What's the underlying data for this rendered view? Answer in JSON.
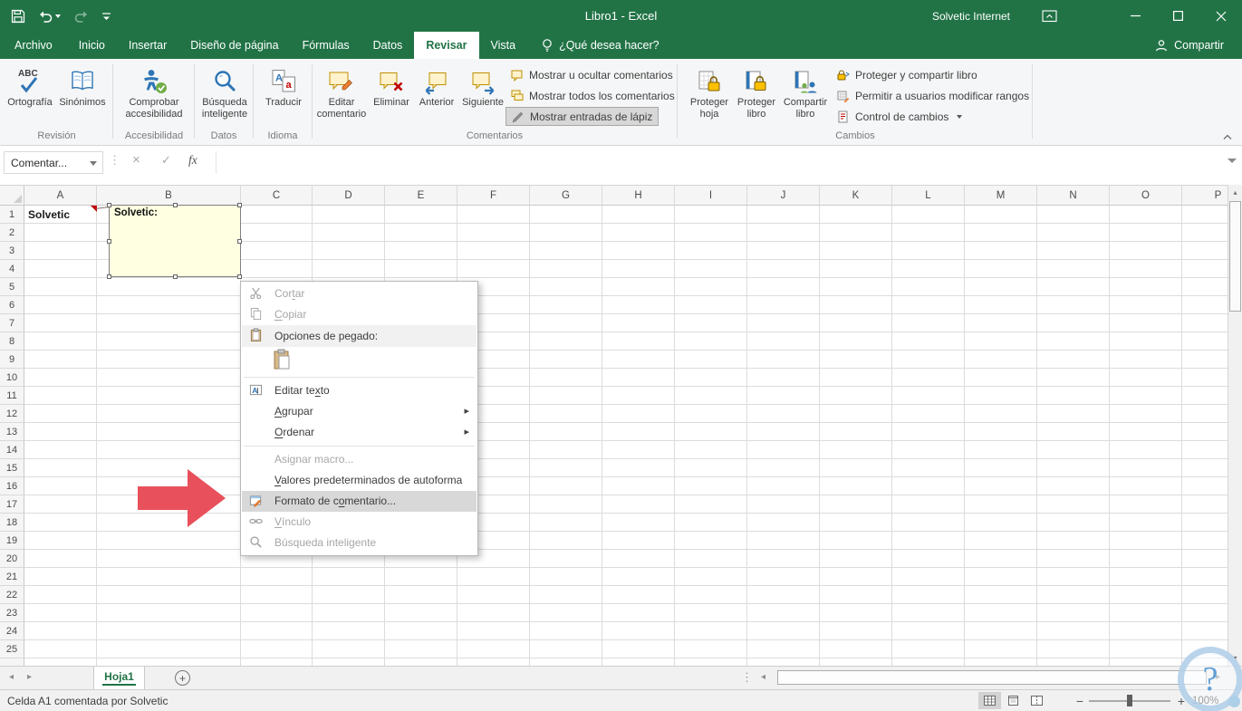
{
  "colors": {
    "excel_green": "#217346",
    "arrow_red": "#e8505b",
    "comment_bg": "#ffffe1"
  },
  "titlebar": {
    "title": "Libro1 - Excel",
    "account": "Solvetic Internet"
  },
  "tabs": {
    "archivo": "Archivo",
    "inicio": "Inicio",
    "insertar": "Insertar",
    "diseno": "Diseño de página",
    "formulas": "Fórmulas",
    "datos": "Datos",
    "revisar": "Revisar",
    "vista": "Vista",
    "tellme": "¿Qué desea hacer?",
    "share": "Compartir"
  },
  "ribbon": {
    "groups": {
      "revision": "Revisión",
      "accesibilidad": "Accesibilidad",
      "datos": "Datos",
      "idioma": "Idioma",
      "comentarios": "Comentarios",
      "cambios": "Cambios"
    },
    "buttons": {
      "ortografia": "Ortografía",
      "sinonimos": "Sinónimos",
      "comprobar_accesibilidad": "Comprobar accesibilidad",
      "busqueda_inteligente": "Búsqueda inteligente",
      "traducir": "Traducir",
      "editar_comentario": "Editar comentario",
      "eliminar": "Eliminar",
      "anterior": "Anterior",
      "siguiente": "Siguiente",
      "mostrar_ocultar": "Mostrar u ocultar comentarios",
      "mostrar_todos": "Mostrar todos los comentarios",
      "mostrar_lapiz": "Mostrar entradas de lápiz",
      "proteger_hoja": "Proteger hoja",
      "proteger_libro": "Proteger libro",
      "compartir_libro": "Compartir libro",
      "proteger_compartir": "Proteger y compartir libro",
      "permitir_rangos": "Permitir a usuarios modificar rangos",
      "control_cambios": "Control de cambios"
    }
  },
  "formula_bar": {
    "name_box": "Comentar...",
    "fx": "fx"
  },
  "grid": {
    "columns": [
      "A",
      "B",
      "C",
      "D",
      "E",
      "F",
      "G",
      "H",
      "I",
      "J",
      "K",
      "L",
      "M",
      "N",
      "O",
      "P"
    ],
    "rows": [
      1,
      2,
      3,
      4,
      5,
      6,
      7,
      8,
      9,
      10,
      11,
      12,
      13,
      14,
      15,
      16,
      17,
      18,
      19,
      20,
      21,
      22,
      23,
      24,
      25
    ],
    "cell_a1": "Solvetic",
    "comment_text": "Solvetic:"
  },
  "context_menu": {
    "cut": {
      "pre": "Cor",
      "accel": "t",
      "post": "ar"
    },
    "copy": {
      "pre": "",
      "accel": "C",
      "post": "opiar"
    },
    "paste_options": "Opciones de pegado:",
    "edit_text": {
      "pre": "Editar te",
      "accel": "x",
      "post": "to"
    },
    "group": {
      "pre": "",
      "accel": "A",
      "post": "grupar"
    },
    "order": {
      "pre": "",
      "accel": "O",
      "post": "rdenar"
    },
    "assign_macro": {
      "pre": "Asignar macro...",
      "accel": "",
      "post": ""
    },
    "autoshape_defaults": {
      "pre": "",
      "accel": "V",
      "post": "alores predeterminados de autoforma"
    },
    "format_comment": {
      "pre": "Formato de c",
      "accel": "o",
      "post": "mentario..."
    },
    "link": {
      "pre": "",
      "accel": "V",
      "post": "ínculo"
    },
    "smart_lookup": {
      "pre": "Búsqueda inteligente",
      "accel": "",
      "post": ""
    }
  },
  "sheet_tabs": {
    "sheet1": "Hoja1"
  },
  "status_bar": {
    "message": "Celda A1 comentada por Solvetic",
    "zoom": "100%"
  },
  "help_bubble": "?"
}
